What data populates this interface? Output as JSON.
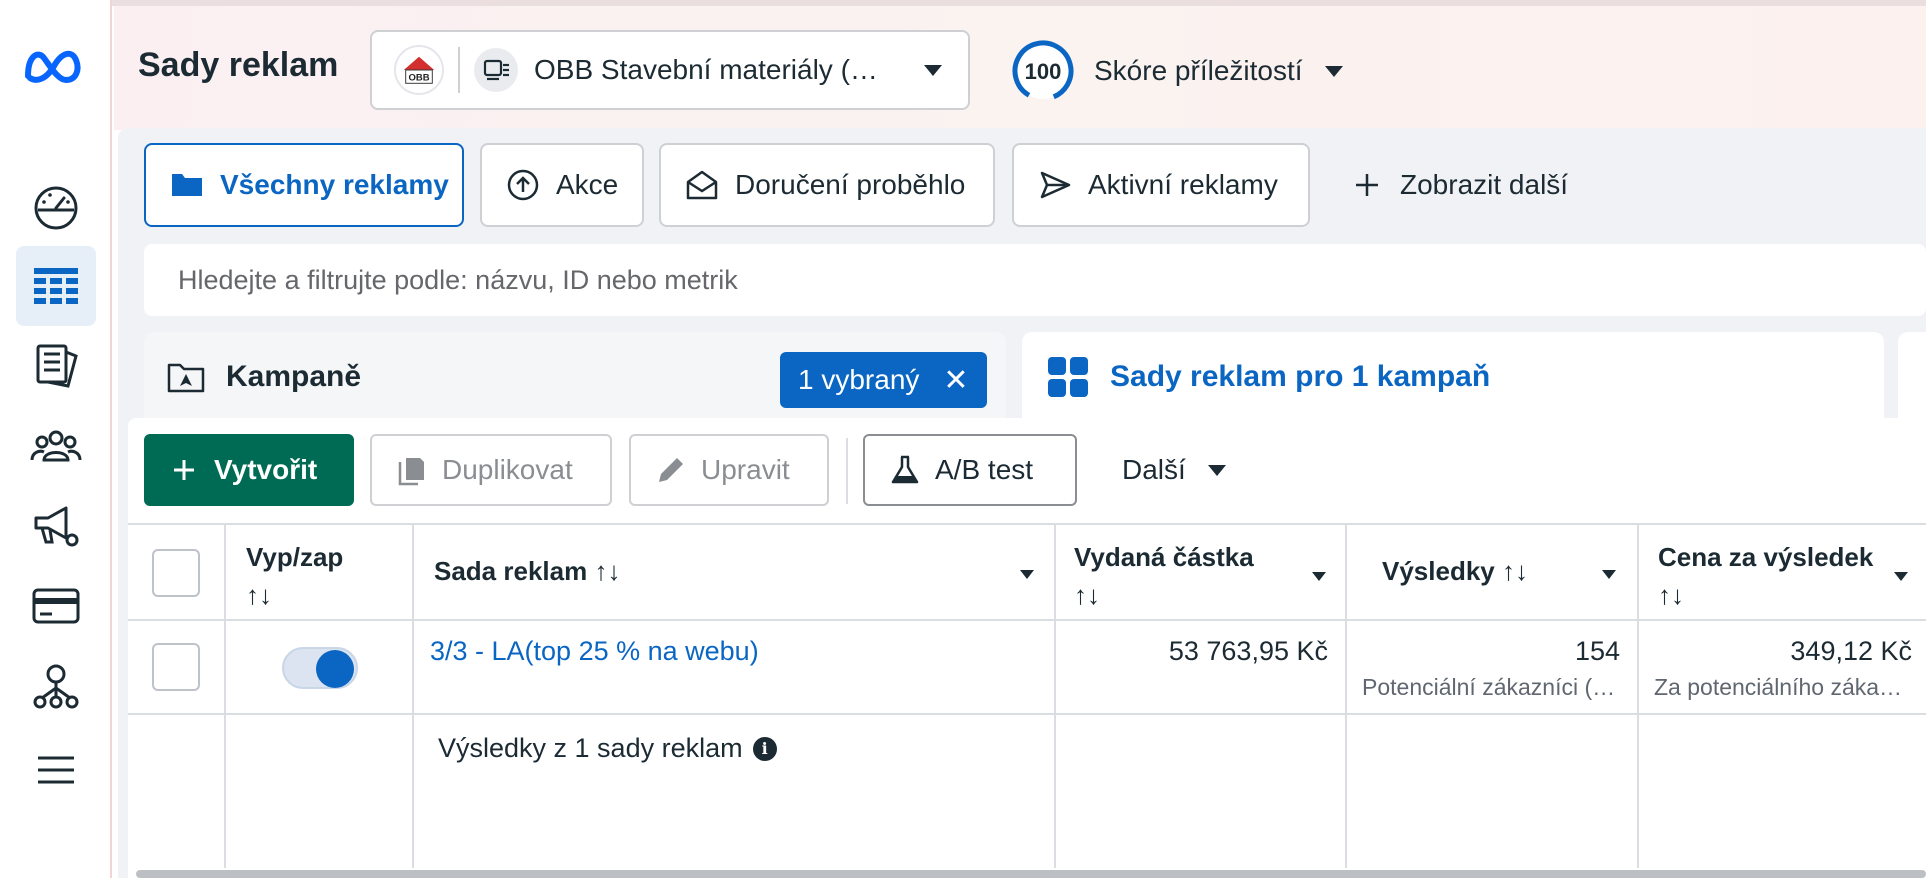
{
  "header": {
    "page_title": "Sady reklam",
    "account_name": "OBB Stavební materiály (…",
    "account_logo_text": "OBB",
    "score_value": "100",
    "score_label": "Skóre příležitostí"
  },
  "nav_icons": [
    "meta-logo-icon",
    "dashboard-gauge-icon",
    "table-grid-icon",
    "pages-icon",
    "audience-icon",
    "megaphone-settings-icon",
    "billing-card-icon",
    "network-icon",
    "menu-icon"
  ],
  "filter_tabs": [
    {
      "label": "Všechny reklamy",
      "icon": "folder-icon",
      "active": true
    },
    {
      "label": "Akce",
      "icon": "circle-arrow-up-icon"
    },
    {
      "label": "Doručení proběhlo",
      "icon": "envelope-open-icon"
    },
    {
      "label": "Aktivní reklamy",
      "icon": "paper-plane-icon"
    },
    {
      "label": "Zobrazit další",
      "icon": "plus-icon"
    }
  ],
  "search": {
    "placeholder": "Hledejte a filtrujte podle: názvu, ID nebo metrik"
  },
  "levels": {
    "campaigns_label": "Kampaně",
    "selected_label": "1 vybraný",
    "adsets_label": "Sady reklam pro 1 kampaň"
  },
  "toolbar": {
    "create": "Vytvořit",
    "duplicate": "Duplikovat",
    "edit": "Upravit",
    "ab_test": "A/B test",
    "more": "Další"
  },
  "table": {
    "columns": {
      "onoff": "Vyp/zap",
      "name": "Sada reklam",
      "spent": "Vydaná částka",
      "results": "Výsledky",
      "cost": "Cena za výsledek"
    },
    "sort_glyph": "↑↓",
    "rows": [
      {
        "name": "3/3 - LA(top 25 % na webu)",
        "spent": "53 763,95 Kč",
        "results": "154",
        "results_sub": "Potenciální zákazníci (…",
        "cost": "349,12 Kč",
        "cost_sub": "Za potenciálního záka…"
      }
    ],
    "summary": "Výsledky z 1 sady reklam",
    "summary_info": "i"
  },
  "colors": {
    "accent": "#0a66c2",
    "create_button": "#006b54",
    "text": "#1c2b33"
  }
}
